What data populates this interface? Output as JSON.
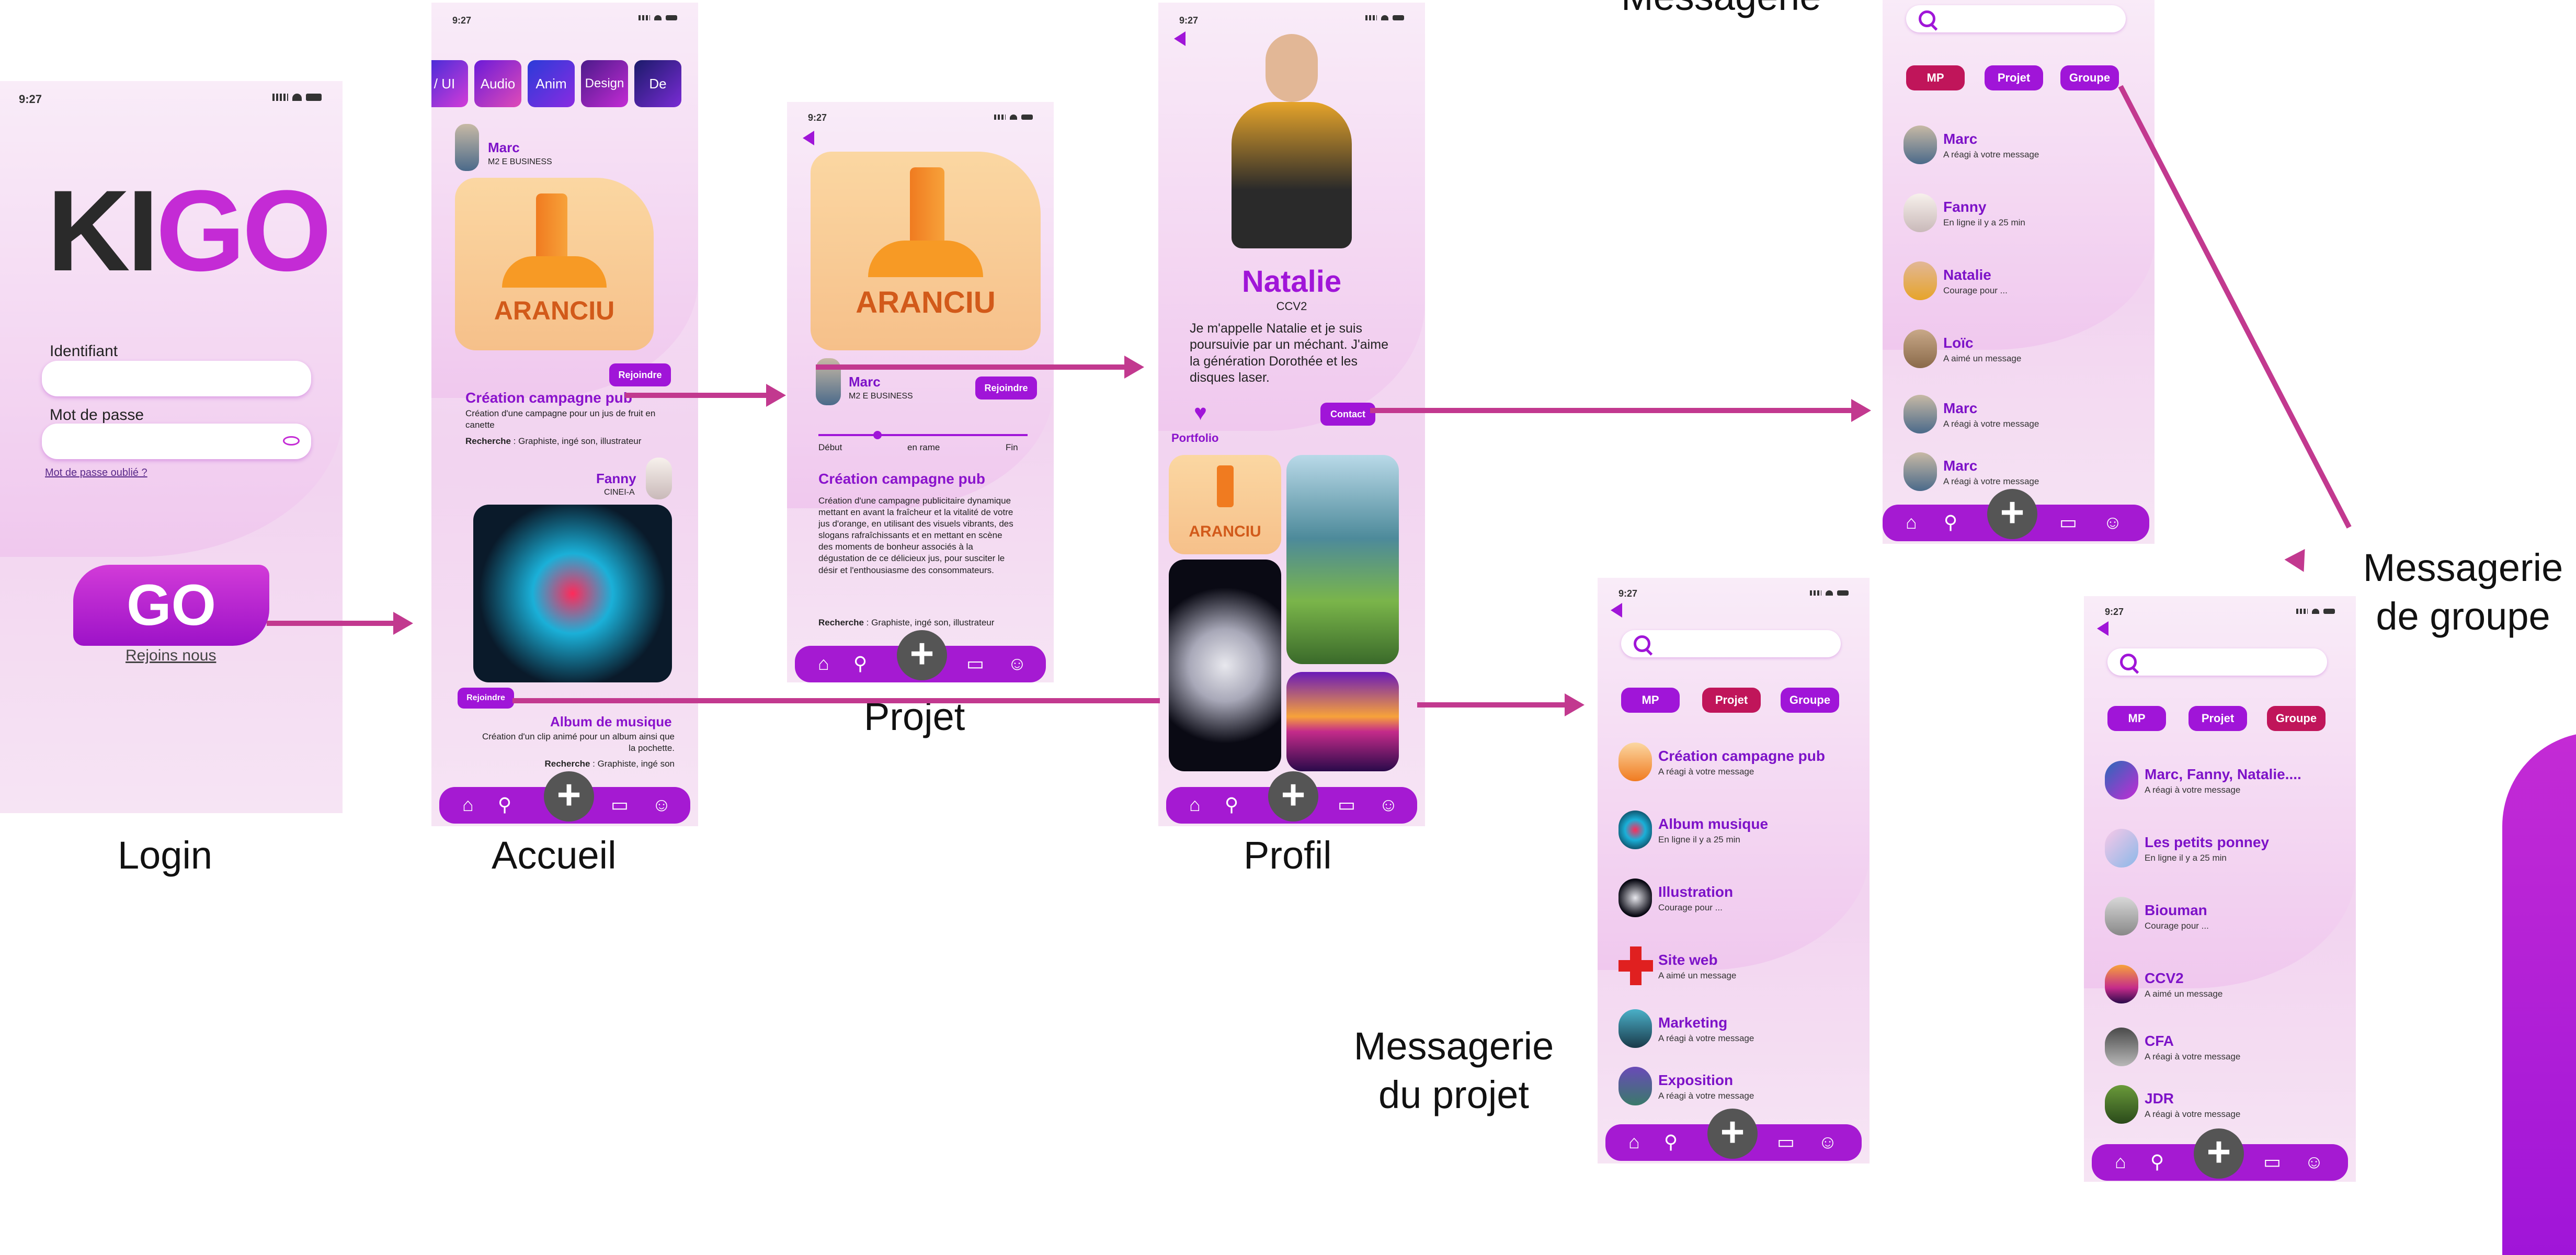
{
  "colors": {
    "accent": "#a015d8",
    "arrow": "#c2398f",
    "alt": "#c0155a"
  },
  "status_time": "9:27",
  "captions": {
    "login": "Login",
    "accueil": "Accueil",
    "projet": "Projet",
    "profil": "Profil",
    "messagerie": "Messagerie",
    "messagerie_projet": "Messagerie du projet",
    "messagerie_groupe": "Messagerie de groupe"
  },
  "login": {
    "logo_k": "KI",
    "logo_go": "GO",
    "identifiant_label": "Identifiant",
    "password_label": "Mot de passe",
    "forgot": "Mot de passe oublié ?",
    "go_label": "GO",
    "join": "Rejoins nous"
  },
  "accueil": {
    "categories": [
      "/ UI",
      "Audio",
      "Anim",
      "Design",
      "De"
    ],
    "post1": {
      "author": "Marc",
      "role": "M2 E BUSINESS",
      "product": "ARANCIU",
      "join": "Rejoindre",
      "title": "Création campagne pub",
      "desc": "Création d'une campagne pour un jus de fruit en canette",
      "search_label": "Recherche",
      "search_value": " : Graphiste, ingé son, illustrateur"
    },
    "post2": {
      "author": "Fanny",
      "role": "CINEI-A",
      "join": "Rejoindre",
      "title": "Album de musique",
      "desc": "Création d'un clip animé pour un album ainsi que la pochette.",
      "search_label": "Recherche",
      "search_value": " : Graphiste, ingé son"
    }
  },
  "projet": {
    "product": "ARANCIU",
    "author": "Marc",
    "role": "M2 E BUSINESS",
    "join": "Rejoindre",
    "timeline": [
      "Début",
      "en rame",
      "Fin"
    ],
    "title": "Création campagne pub",
    "desc": "Création d'une campagne publicitaire dynamique mettant en avant la fraîcheur et la vitalité de votre jus d'orange, en utilisant des visuels vibrants, des slogans rafraîchissants et en mettant en scène des moments de bonheur associés à la dégustation de ce délicieux jus, pour susciter le désir et l'enthousiasme des consommateurs.",
    "search_label": "Recherche",
    "search_value": " : Graphiste, ingé son, illustrateur"
  },
  "profil": {
    "name": "Natalie",
    "role": "CCV2",
    "bio": "Je m'appelle Natalie et je suis poursuivie par un méchant. J'aime la génération Dorothée et les disques laser.",
    "contact": "Contact",
    "portfolio": "Portfolio",
    "product": "ARANCIU"
  },
  "messagerie": {
    "tabs": [
      "MP",
      "Projet",
      "Groupe"
    ],
    "items": [
      {
        "name": "Marc",
        "sub": "A réagi à votre message"
      },
      {
        "name": "Fanny",
        "sub": "En ligne il y a 25 min"
      },
      {
        "name": "Natalie",
        "sub": "Courage pour ..."
      },
      {
        "name": "Loïc",
        "sub": "A aimé un message"
      },
      {
        "name": "Marc",
        "sub": "A réagi à votre message"
      },
      {
        "name": "Marc",
        "sub": "A réagi à votre message"
      }
    ]
  },
  "messagerie_projet": {
    "tabs": [
      "MP",
      "Projet",
      "Groupe"
    ],
    "items": [
      {
        "name": "Création campagne pub",
        "sub": "A réagi à votre message"
      },
      {
        "name": "Album musique",
        "sub": "En ligne il y a 25 min"
      },
      {
        "name": "Illustration",
        "sub": "Courage pour ..."
      },
      {
        "name": "Site web",
        "sub": "A aimé un message"
      },
      {
        "name": "Marketing",
        "sub": "A réagi à votre message"
      },
      {
        "name": "Exposition",
        "sub": "A réagi à votre message"
      }
    ]
  },
  "messagerie_groupe": {
    "tabs": [
      "MP",
      "Projet",
      "Groupe"
    ],
    "items": [
      {
        "name": "Marc, Fanny, Natalie....",
        "sub": "A réagi à votre message"
      },
      {
        "name": "Les petits ponney",
        "sub": "En ligne il y a 25 min"
      },
      {
        "name": "Biouman",
        "sub": "Courage pour ..."
      },
      {
        "name": "CCV2",
        "sub": "A aimé un message"
      },
      {
        "name": "CFA",
        "sub": "A réagi à votre message"
      },
      {
        "name": "JDR",
        "sub": "A réagi à votre message"
      }
    ]
  }
}
